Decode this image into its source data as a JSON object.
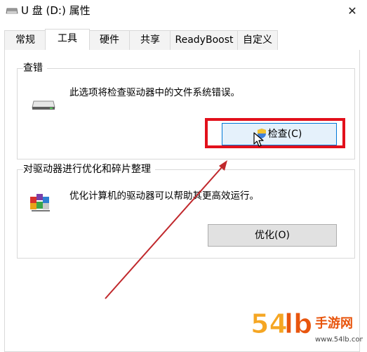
{
  "window": {
    "title": "U 盘 (D:) 属性",
    "close": "✕"
  },
  "tabs": [
    {
      "label": "常规",
      "active": false
    },
    {
      "label": "工具",
      "active": true
    },
    {
      "label": "硬件",
      "active": false
    },
    {
      "label": "共享",
      "active": false
    },
    {
      "label": "ReadyBoost",
      "active": false
    },
    {
      "label": "自定义",
      "active": false
    }
  ],
  "check_group": {
    "title": "查错",
    "description": "此选项将检查驱动器中的文件系统错误。",
    "button_label": "检查(C)"
  },
  "optimize_group": {
    "title": "对驱动器进行优化和碎片整理",
    "description": "优化计算机的驱动器可以帮助其更高效运行。",
    "button_label": "优化(O)"
  },
  "annotation": {
    "highlight_color": "#e2101b",
    "arrow_color": "#c0282c"
  },
  "watermark": {
    "logo": "54lb手游网",
    "url": "www.54lb.com"
  }
}
